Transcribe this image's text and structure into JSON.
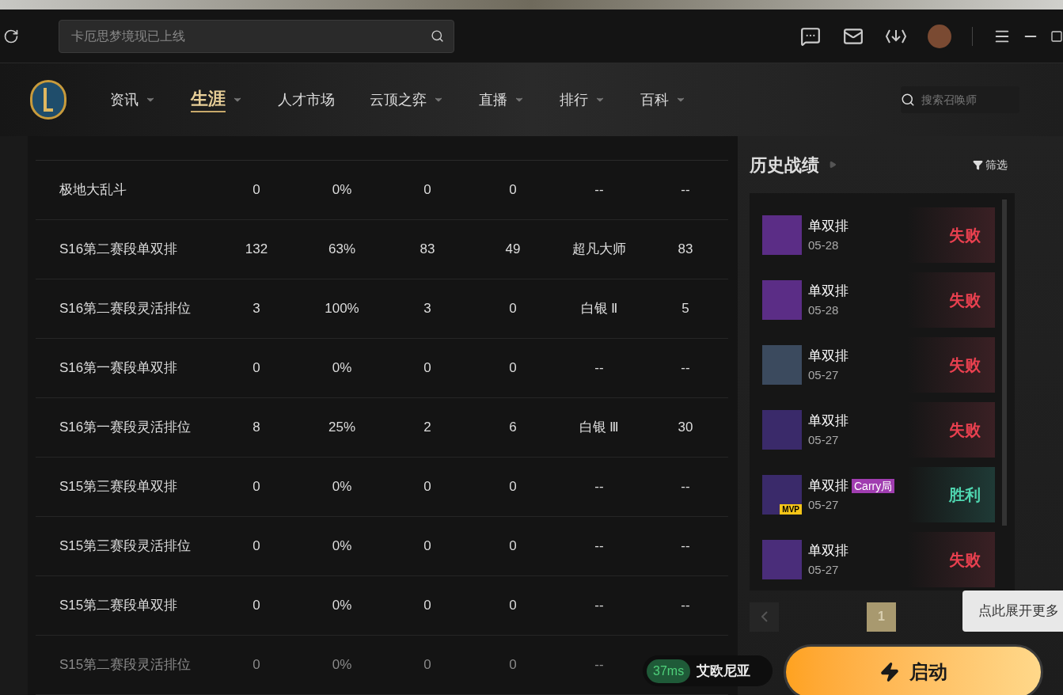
{
  "top_bar": {
    "search": {
      "placeholder": "卡厄思梦境现已上线"
    }
  },
  "nav": {
    "items": [
      {
        "label": "资讯",
        "selected": false,
        "dropdown": true
      },
      {
        "label": "生涯",
        "selected": true,
        "dropdown": true
      },
      {
        "label": "人才市场",
        "selected": false,
        "dropdown": false
      },
      {
        "label": "云顶之弈",
        "selected": false,
        "dropdown": true
      },
      {
        "label": "直播",
        "selected": false,
        "dropdown": true
      },
      {
        "label": "排行",
        "selected": false,
        "dropdown": true
      },
      {
        "label": "百科",
        "selected": false,
        "dropdown": true
      }
    ],
    "summoner_search": {
      "placeholder": "搜索召唤师"
    }
  },
  "table": {
    "rows": [
      {
        "cells": [
          "极地大乱斗",
          "0",
          "0%",
          "0",
          "0",
          "--",
          "--"
        ],
        "faded": false
      },
      {
        "cells": [
          "S16第二赛段单双排",
          "132",
          "63%",
          "83",
          "49",
          "超凡大师",
          "83"
        ],
        "faded": false
      },
      {
        "cells": [
          "S16第二赛段灵活排位",
          "3",
          "100%",
          "3",
          "0",
          "白银 Ⅱ",
          "5"
        ],
        "faded": false
      },
      {
        "cells": [
          "S16第一赛段单双排",
          "0",
          "0%",
          "0",
          "0",
          "--",
          "--"
        ],
        "faded": false
      },
      {
        "cells": [
          "S16第一赛段灵活排位",
          "8",
          "25%",
          "2",
          "6",
          "白银 Ⅲ",
          "30"
        ],
        "faded": false
      },
      {
        "cells": [
          "S15第三赛段单双排",
          "0",
          "0%",
          "0",
          "0",
          "--",
          "--"
        ],
        "faded": false
      },
      {
        "cells": [
          "S15第三赛段灵活排位",
          "0",
          "0%",
          "0",
          "0",
          "--",
          "--"
        ],
        "faded": false
      },
      {
        "cells": [
          "S15第二赛段单双排",
          "0",
          "0%",
          "0",
          "0",
          "--",
          "--"
        ],
        "faded": false
      },
      {
        "cells": [
          "S15第二赛段灵活排位",
          "0",
          "0%",
          "0",
          "0",
          "--"
        ],
        "faded": true
      }
    ]
  },
  "history": {
    "title": "历史战绩",
    "filter": "筛选",
    "matches": [
      {
        "mode": "单双排",
        "date": "05-28",
        "result": "失败",
        "kind": "loss"
      },
      {
        "mode": "单双排",
        "date": "05-28",
        "result": "失败",
        "kind": "loss"
      },
      {
        "mode": "单双排",
        "date": "05-27",
        "result": "失败",
        "kind": "loss"
      },
      {
        "mode": "单双排",
        "date": "05-27",
        "result": "失败",
        "kind": "loss"
      },
      {
        "mode": "单双排",
        "tag": "Carry局",
        "date": "05-27",
        "result": "胜利",
        "kind": "win",
        "mvp_label": "MVP"
      },
      {
        "mode": "单双排",
        "date": "05-27",
        "result": "失败",
        "kind": "loss"
      }
    ],
    "pages": [
      {
        "label": "1",
        "selected": true
      }
    ]
  },
  "tooltip": "点此展开更多",
  "footer": {
    "ping": "37ms",
    "server": "艾欧尼亚",
    "start": "启动"
  }
}
